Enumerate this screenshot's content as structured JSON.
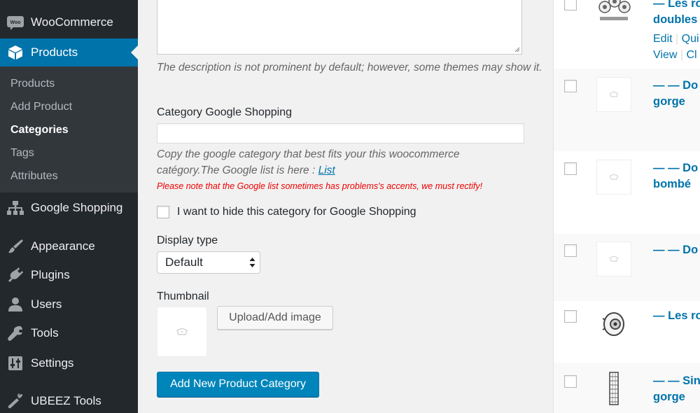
{
  "sidebar": {
    "woocommerce": "WooCommerce",
    "products": "Products",
    "submenu": [
      "Products",
      "Add Product",
      "Categories",
      "Tags",
      "Attributes"
    ],
    "google_shopping": "Google Shopping",
    "appearance": "Appearance",
    "plugins": "Plugins",
    "users": "Users",
    "tools": "Tools",
    "settings": "Settings",
    "ubeez": "UBEEZ Tools"
  },
  "form": {
    "description_help": "The description is not prominent by default; however, some themes may show it.",
    "category_google_label": "Category Google Shopping",
    "category_google_value": "",
    "google_help_text": "Copy the google category that best fits your this woocommerce catégory.The Google list is here : ",
    "google_help_link": "List",
    "google_warning": "Please note that the Google list sometimes has problems's accents, we must rectify!",
    "hide_checkbox_label": "I want to hide this category for Google Shopping",
    "display_type_label": "Display type",
    "display_type_value": "Default",
    "thumbnail_label": "Thumbnail",
    "upload_button": "Upload/Add image",
    "submit_button": "Add New Product Category"
  },
  "table": {
    "rows": [
      {
        "title_line1": "— Les ro",
        "title_line2": "doubles",
        "actions_line1": [
          "Edit",
          "Qui"
        ],
        "actions_line2": [
          "View",
          "Cl"
        ]
      },
      {
        "title_line1": "— — Do",
        "title_line2": "gorge"
      },
      {
        "title_line1": "— — Do",
        "title_line2": "bombé"
      },
      {
        "title_line1": "— — Do"
      },
      {
        "title_line1": "— Les ro"
      },
      {
        "title_line1": "— — Sin",
        "title_line2": "gorge"
      }
    ]
  },
  "colors": {
    "sidebar_bg": "#23282d",
    "submenu_bg": "#32373c",
    "accent": "#0073aa",
    "primary_button": "#0085ba",
    "warning": "#ee0000"
  }
}
